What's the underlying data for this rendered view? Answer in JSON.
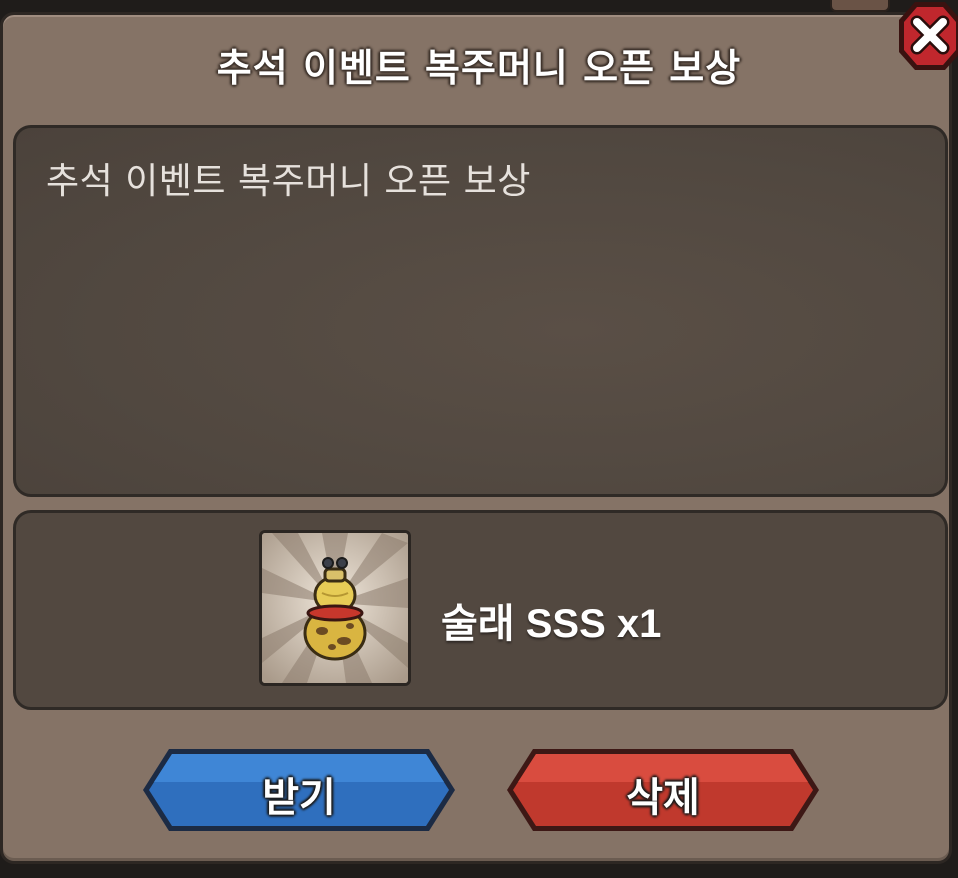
{
  "dialog": {
    "title": "추석 이벤트 복주머니 오픈 보상",
    "message": "추석 이벤트 복주머니 오픈 보상"
  },
  "reward": {
    "item_icon": "gourd-bottle-icon",
    "label": "술래 SSS x1"
  },
  "buttons": {
    "receive_label": "받기",
    "delete_label": "삭제",
    "close_icon": "close-icon"
  },
  "colors": {
    "dialog_bg": "#857366",
    "panel_bg": "#524840",
    "receive_button": "#2d6bb5",
    "delete_button": "#c23a2d",
    "close_button": "#c0272d"
  }
}
